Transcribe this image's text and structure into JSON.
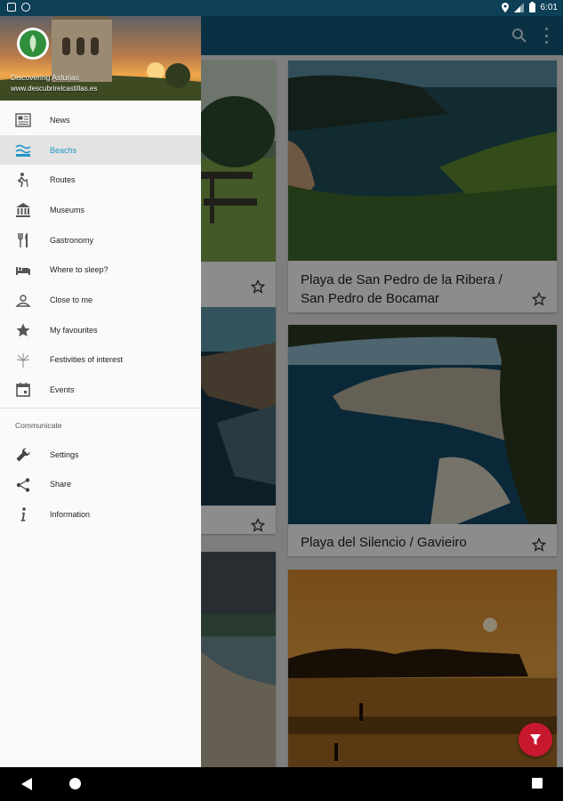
{
  "status_bar": {
    "time": "6:01"
  },
  "drawer": {
    "app_name": "Discovering Asturias",
    "website": "www.descubrirelcastillas.es",
    "items": [
      {
        "label": "News",
        "icon": "news-icon"
      },
      {
        "label": "Beachs",
        "icon": "beach-icon",
        "active": true
      },
      {
        "label": "Routes",
        "icon": "hiking-icon"
      },
      {
        "label": "Museums",
        "icon": "museum-icon"
      },
      {
        "label": "Gastronomy",
        "icon": "cutlery-icon"
      },
      {
        "label": "Where to sleep?",
        "icon": "bed-icon"
      },
      {
        "label": "Close to me",
        "icon": "location-person-icon"
      },
      {
        "label": "My favourites",
        "icon": "star-icon"
      },
      {
        "label": "Festivities of interest",
        "icon": "fireworks-icon"
      },
      {
        "label": "Events",
        "icon": "calendar-icon"
      }
    ],
    "section_title": "Communicate",
    "secondary_items": [
      {
        "label": "Settings",
        "icon": "wrench-icon"
      },
      {
        "label": "Share",
        "icon": "share-icon"
      },
      {
        "label": "Information",
        "icon": "info-icon"
      }
    ]
  },
  "cards": [
    {
      "title": "Playa de San Pedro de la Ribera / San Pedro de Bocamar"
    },
    {
      "title": "Playa del Silencio / Gavieiro"
    }
  ],
  "colors": {
    "status_bar": "#0d3f57",
    "app_bar": "#135a7a",
    "accent": "#2196c9",
    "fab": "#c7182f"
  }
}
